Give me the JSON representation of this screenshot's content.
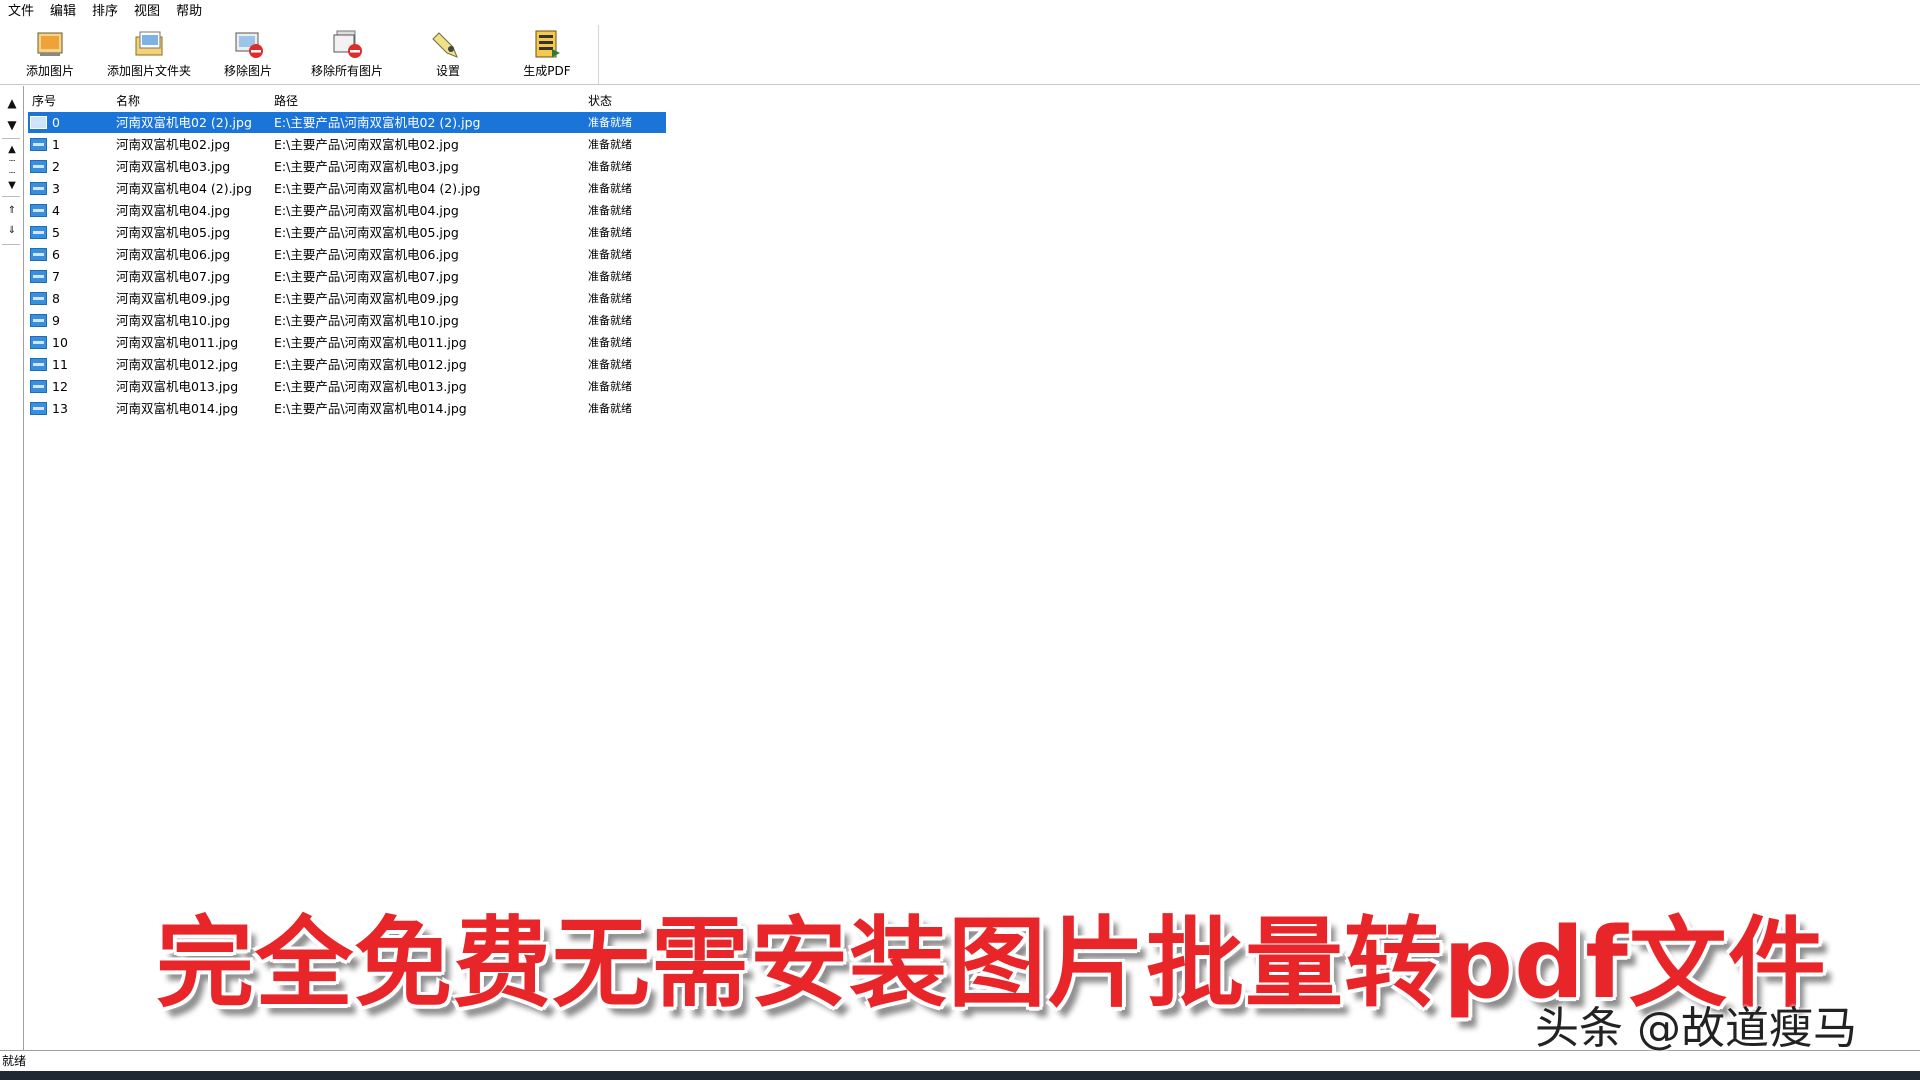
{
  "menu": [
    "文件",
    "编辑",
    "排序",
    "视图",
    "帮助"
  ],
  "toolbar": {
    "add_image": "添加图片",
    "add_folder": "添加图片文件夹",
    "remove_image": "移除图片",
    "remove_all": "移除所有图片",
    "settings": "设置",
    "generate_pdf": "生成PDF"
  },
  "list": {
    "headers": {
      "index": "序号",
      "name": "名称",
      "path": "路径",
      "status": "状态"
    },
    "rows": [
      {
        "index": "0",
        "name": "河南双富机电02 (2).jpg",
        "path": "E:\\主要产品\\河南双富机电02 (2).jpg",
        "status": "准备就绪"
      },
      {
        "index": "1",
        "name": "河南双富机电02.jpg",
        "path": "E:\\主要产品\\河南双富机电02.jpg",
        "status": "准备就绪"
      },
      {
        "index": "2",
        "name": "河南双富机电03.jpg",
        "path": "E:\\主要产品\\河南双富机电03.jpg",
        "status": "准备就绪"
      },
      {
        "index": "3",
        "name": "河南双富机电04 (2).jpg",
        "path": "E:\\主要产品\\河南双富机电04 (2).jpg",
        "status": "准备就绪"
      },
      {
        "index": "4",
        "name": "河南双富机电04.jpg",
        "path": "E:\\主要产品\\河南双富机电04.jpg",
        "status": "准备就绪"
      },
      {
        "index": "5",
        "name": "河南双富机电05.jpg",
        "path": "E:\\主要产品\\河南双富机电05.jpg",
        "status": "准备就绪"
      },
      {
        "index": "6",
        "name": "河南双富机电06.jpg",
        "path": "E:\\主要产品\\河南双富机电06.jpg",
        "status": "准备就绪"
      },
      {
        "index": "7",
        "name": "河南双富机电07.jpg",
        "path": "E:\\主要产品\\河南双富机电07.jpg",
        "status": "准备就绪"
      },
      {
        "index": "8",
        "name": "河南双富机电09.jpg",
        "path": "E:\\主要产品\\河南双富机电09.jpg",
        "status": "准备就绪"
      },
      {
        "index": "9",
        "name": "河南双富机电10.jpg",
        "path": "E:\\主要产品\\河南双富机电10.jpg",
        "status": "准备就绪"
      },
      {
        "index": "10",
        "name": "河南双富机电011.jpg",
        "path": "E:\\主要产品\\河南双富机电011.jpg",
        "status": "准备就绪"
      },
      {
        "index": "11",
        "name": "河南双富机电012.jpg",
        "path": "E:\\主要产品\\河南双富机电012.jpg",
        "status": "准备就绪"
      },
      {
        "index": "12",
        "name": "河南双富机电013.jpg",
        "path": "E:\\主要产品\\河南双富机电013.jpg",
        "status": "准备就绪"
      },
      {
        "index": "13",
        "name": "河南双富机电014.jpg",
        "path": "E:\\主要产品\\河南双富机电014.jpg",
        "status": "准备就绪"
      }
    ]
  },
  "status_bar": "就绪",
  "overlay_title": "完全免费无需安装图片批量转pdf文件",
  "watermark": "头条 @故道瘦马",
  "colors": {
    "selection": "#1b74d8",
    "overlay_red": "#e8262a"
  }
}
